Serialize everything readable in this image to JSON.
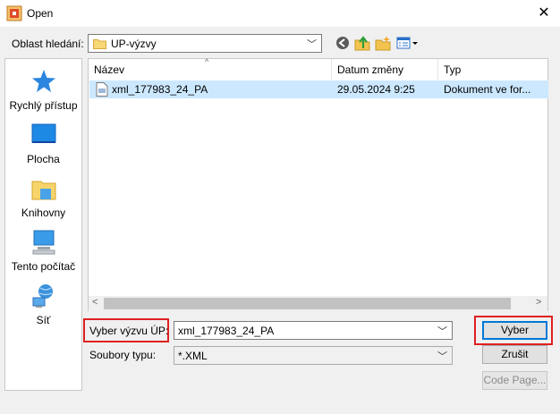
{
  "window": {
    "title": "Open",
    "close_glyph": "✕"
  },
  "lookin": {
    "label": "Oblast hledání:",
    "value": "UP-výzvy",
    "folder_icon": "folder-icon"
  },
  "toolbar": {
    "icons": [
      "back-icon",
      "up-folder-icon",
      "new-folder-icon",
      "view-menu-icon"
    ]
  },
  "places": [
    {
      "label": "Rychlý přístup",
      "icon": "star-icon"
    },
    {
      "label": "Plocha",
      "icon": "desktop-icon"
    },
    {
      "label": "Knihovny",
      "icon": "libraries-icon"
    },
    {
      "label": "Tento počítač",
      "icon": "computer-icon"
    },
    {
      "label": "Síť",
      "icon": "network-icon"
    }
  ],
  "filelist": {
    "columns": [
      "Název",
      "Datum změny",
      "Typ"
    ],
    "sort_arrow": "^",
    "rows": [
      {
        "name": "xml_177983_24_PA",
        "date": "29.05.2024 9:25",
        "type": "Dokument ve for..."
      }
    ],
    "scroll_left": "<",
    "scroll_right": ">"
  },
  "filename": {
    "label": "Vyber výzvu ÚP:",
    "value": "xml_177983_24_PA"
  },
  "filetype": {
    "label": "Soubory typu:",
    "value": "*.XML"
  },
  "buttons": {
    "ok": "Vyber",
    "cancel": "Zrušit",
    "code_page": "Code Page..."
  },
  "colors": {
    "selection": "#cce8ff",
    "highlight_border": "#e02020",
    "default_button_border": "#0078d7"
  }
}
